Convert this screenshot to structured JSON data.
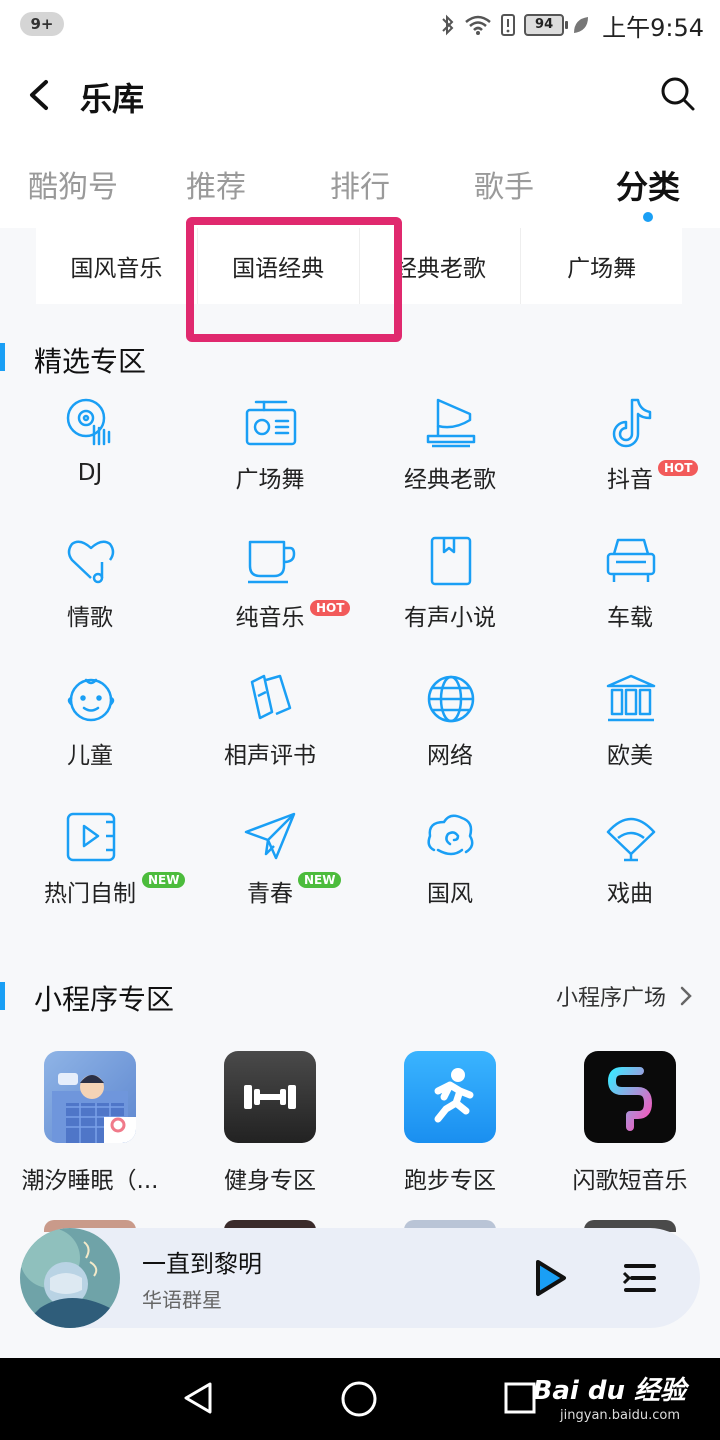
{
  "status_bar": {
    "notification_count": "9+",
    "battery": "94",
    "time": "上午9:54"
  },
  "header": {
    "title": "乐库"
  },
  "tabs": [
    {
      "label": "酷狗号"
    },
    {
      "label": "推荐"
    },
    {
      "label": "排行"
    },
    {
      "label": "歌手"
    },
    {
      "label": "分类",
      "active": true
    }
  ],
  "sub_categories": [
    {
      "label": "国风音乐"
    },
    {
      "label": "国语经典"
    },
    {
      "label": "经典老歌"
    },
    {
      "label": "广场舞"
    }
  ],
  "featured": {
    "title": "精选专区",
    "items": [
      {
        "label": "DJ",
        "icon": "dj-disc-icon"
      },
      {
        "label": "广场舞",
        "icon": "radio-icon"
      },
      {
        "label": "经典老歌",
        "icon": "gramophone-icon"
      },
      {
        "label": "抖音",
        "icon": "douyin-note-icon",
        "badge": "HOT"
      },
      {
        "label": "情歌",
        "icon": "heart-note-icon"
      },
      {
        "label": "纯音乐",
        "icon": "cup-icon",
        "badge": "HOT"
      },
      {
        "label": "有声小说",
        "icon": "book-icon"
      },
      {
        "label": "车载",
        "icon": "car-icon"
      },
      {
        "label": "儿童",
        "icon": "baby-face-icon"
      },
      {
        "label": "相声评书",
        "icon": "clapper-icon"
      },
      {
        "label": "网络",
        "icon": "globe-icon"
      },
      {
        "label": "欧美",
        "icon": "columns-icon"
      },
      {
        "label": "热门自制",
        "icon": "video-play-icon",
        "badge": "NEW"
      },
      {
        "label": "青春",
        "icon": "paper-plane-icon",
        "badge": "NEW"
      },
      {
        "label": "国风",
        "icon": "cloud-swirl-icon"
      },
      {
        "label": "戏曲",
        "icon": "fan-icon"
      }
    ]
  },
  "mini_programs": {
    "title": "小程序专区",
    "more_label": "小程序广场",
    "items": [
      {
        "label": "潮汐睡眠（..."
      },
      {
        "label": "健身专区"
      },
      {
        "label": "跑步专区"
      },
      {
        "label": "闪歌短音乐"
      }
    ]
  },
  "player": {
    "song_title": "一直到黎明",
    "artist": "华语群星"
  },
  "watermark": {
    "brand": "Bai du 经验",
    "url": "jingyan.baidu.com"
  },
  "colors": {
    "accent": "#1a9ff5",
    "highlight": "#e0296e",
    "hot": "#f25a5a",
    "new": "#4cbc3c"
  }
}
